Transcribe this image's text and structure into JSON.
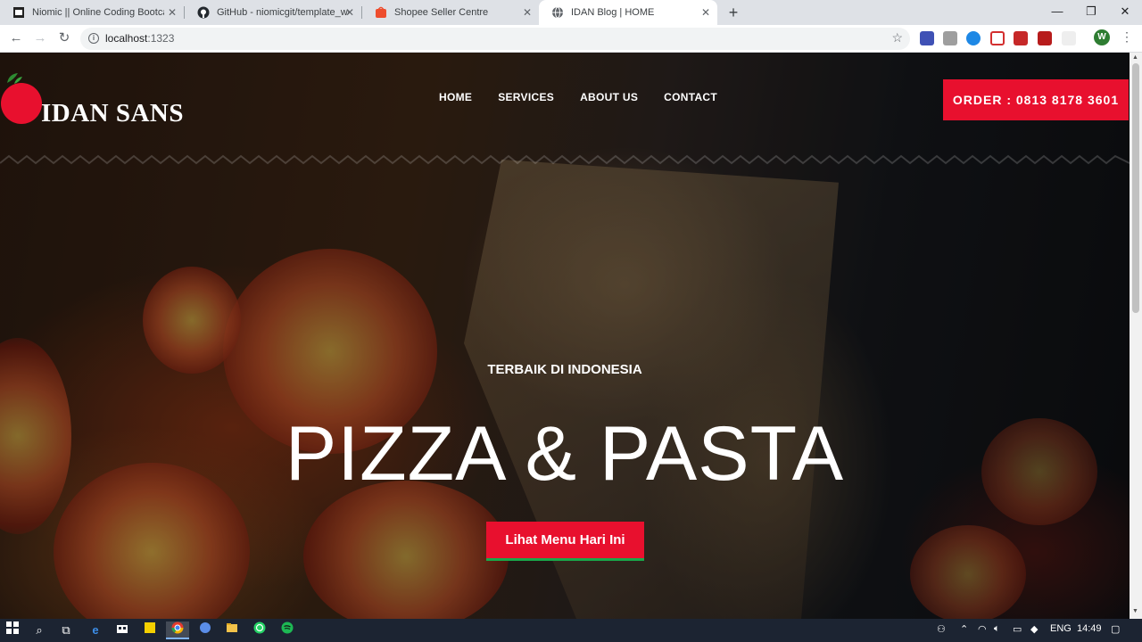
{
  "browser": {
    "tabs": [
      {
        "title": "Niomic || Online Coding Bootcamp",
        "favicon": "niomic-icon",
        "active": false
      },
      {
        "title": "GitHub - niomicgit/template_web",
        "favicon": "github-icon",
        "active": false
      },
      {
        "title": "Shopee Seller Centre",
        "favicon": "shopee-icon",
        "active": false
      },
      {
        "title": "IDAN Blog | HOME",
        "favicon": "globe-icon",
        "active": true
      }
    ],
    "url_host": "localhost",
    "url_port": ":1323",
    "profile_initial": "W"
  },
  "site": {
    "brand": "IDAN SANS",
    "nav": [
      "HOME",
      "SERVICES",
      "ABOUT US",
      "CONTACT"
    ],
    "order_label": "ORDER : 0813 8178 3601",
    "tagline": "TERBAIK DI INDONESIA",
    "headline": "PIZZA & PASTA",
    "cta_label": "Lihat Menu Hari Ini",
    "colors": {
      "accent": "#e8102e",
      "cta_underline": "#19a84a"
    }
  },
  "taskbar": {
    "language": "ENG",
    "time": "14:49"
  }
}
